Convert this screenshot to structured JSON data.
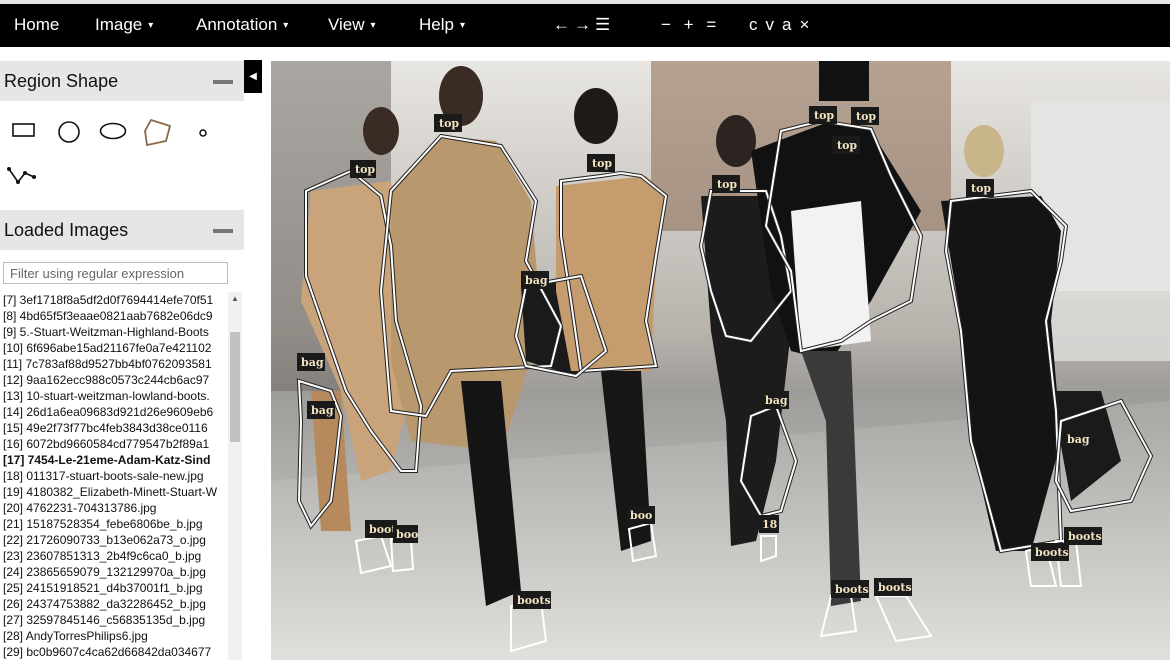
{
  "menu": {
    "home": "Home",
    "image": "Image",
    "annotation": "Annotation",
    "view": "View",
    "help": "Help",
    "caret": "▾"
  },
  "toolbar": {
    "prev": "←",
    "next": "→",
    "list": "☰",
    "zoom_out": "−",
    "zoom_in": "+",
    "zoom_reset": "=",
    "copy": "c",
    "paste": "v",
    "select_all": "a",
    "delete": "×"
  },
  "region_shape": {
    "title": "Region Shape",
    "shapes": [
      "rectangle-icon",
      "circle-icon",
      "ellipse-icon",
      "polygon-icon",
      "point-icon",
      "polyline-icon"
    ],
    "selected": "polygon-icon"
  },
  "loaded_images": {
    "title": "Loaded Images",
    "filter_placeholder": "Filter using regular expression",
    "files": [
      "[7] 3ef1718f8a5df2d0f7694414efe70f51",
      "[8] 4bd65f5f3eaae0821aab7682e06dc9",
      "[9] 5.-Stuart-Weitzman-Highland-Boots",
      "[10] 6f696abe15ad21167fe0a7e421102",
      "[11] 7c783af88d9527bb4bf0762093581",
      "[12] 9aa162ecc988c0573c244cb6ac97",
      "[13] 10-stuart-weitzman-lowland-boots.",
      "[14] 26d1a6ea09683d921d26e9609eb6",
      "[15] 49e2f73f77bc4feb3843d38ce0116",
      "[16] 6072bd9660584cd779547b2f89a1",
      "[17] 7454-Le-21eme-Adam-Katz-Sind",
      "[18] 011317-stuart-boots-sale-new.jpg",
      "[19] 4180382_Elizabeth-Minett-Stuart-W",
      "[20] 4762231-704313786.jpg",
      "[21] 15187528354_febe6806be_b.jpg",
      "[22] 21726090733_b13e062a73_o.jpg",
      "[23] 23607851313_2b4f9c6ca0_b.jpg",
      "[24] 23865659079_132129970a_b.jpg",
      "[25] 24151918521_d4b37001f1_b.jpg",
      "[26] 24374753882_da32286452_b.jpg",
      "[27] 32597845146_c56835135d_b.jpg",
      "[28] AndyTorresPhilips6.jpg",
      "[29] bc0b9607c4ca62d66842da034677"
    ],
    "active_index": 10
  },
  "canvas": {
    "labels": [
      "top",
      "top",
      "top",
      "top",
      "top",
      "top",
      "top",
      "bag",
      "bag",
      "bag",
      "bag",
      "bag",
      "boots",
      "boo",
      "boo",
      "boots",
      "18",
      "boots",
      "boots",
      "boots",
      "boots"
    ]
  }
}
